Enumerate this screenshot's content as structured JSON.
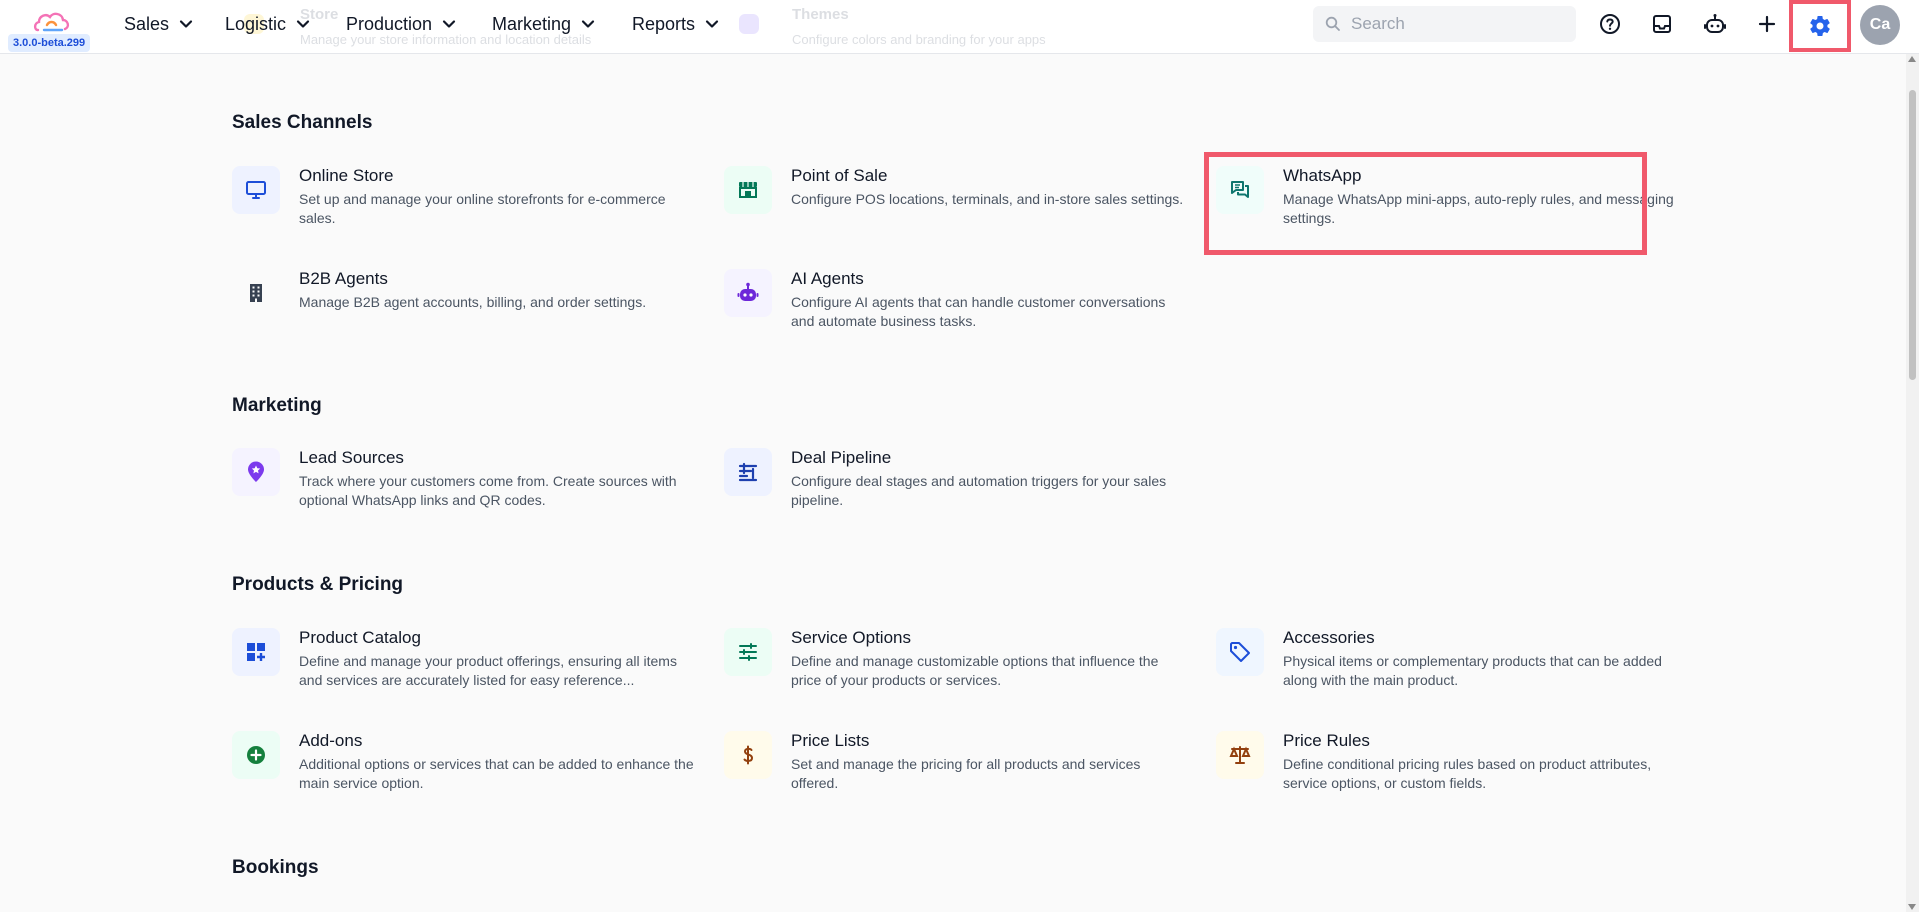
{
  "app": {
    "version": "3.0.0-beta.299"
  },
  "header": {
    "nav": [
      {
        "label": "Sales"
      },
      {
        "label": "Logistic"
      },
      {
        "label": "Production"
      },
      {
        "label": "Marketing"
      },
      {
        "label": "Reports"
      }
    ],
    "ghost": {
      "left_title": "Store",
      "left_sub": "Manage your store information and location details",
      "right_title": "Themes",
      "right_sub": "Configure colors and branding for your apps"
    },
    "search": {
      "placeholder": "Search",
      "value": ""
    },
    "icons": [
      "help-circle-icon",
      "inbox-icon",
      "robot-icon",
      "plus-icon",
      "gear-icon"
    ],
    "avatar_initials": "Ca"
  },
  "colors": {
    "highlight": "#f0596b",
    "accent": "#2563eb"
  },
  "sections": [
    {
      "title": "Sales Channels",
      "cards": [
        {
          "title": "Online Store",
          "desc": "Set up and manage your online storefronts for e-commerce sales.",
          "icon": "monitor-icon"
        },
        {
          "title": "Point of Sale",
          "desc": "Configure POS locations, terminals, and in-store sales settings.",
          "icon": "storefront-icon"
        },
        {
          "title": "WhatsApp",
          "desc": "Manage WhatsApp mini-apps, auto-reply rules, and messaging settings.",
          "icon": "chat-bubbles-icon"
        },
        {
          "title": "B2B Agents",
          "desc": "Manage B2B agent accounts, billing, and order settings.",
          "icon": "building-icon"
        },
        {
          "title": "AI Agents",
          "desc": "Configure AI agents that can handle customer conversations and automate business tasks.",
          "icon": "robot-icon"
        }
      ]
    },
    {
      "title": "Marketing",
      "cards": [
        {
          "title": "Lead Sources",
          "desc": "Track where your customers come from. Create sources with optional WhatsApp links and QR codes.",
          "icon": "location-pin-icon"
        },
        {
          "title": "Deal Pipeline",
          "desc": "Configure deal stages and automation triggers for your sales pipeline.",
          "icon": "pipeline-icon"
        }
      ]
    },
    {
      "title": "Products & Pricing",
      "cards": [
        {
          "title": "Product Catalog",
          "desc": "Define and manage your product offerings, ensuring all items and services are accurately listed for easy reference...",
          "icon": "grid-plus-icon"
        },
        {
          "title": "Service Options",
          "desc": "Define and manage customizable options that influence the price of your products or services.",
          "icon": "sliders-icon"
        },
        {
          "title": "Accessories",
          "desc": "Physical items or complementary products that can be added along with the main product.",
          "icon": "tag-icon"
        },
        {
          "title": "Add-ons",
          "desc": "Additional options or services that can be added to enhance the main service option.",
          "icon": "plus-circle-icon"
        },
        {
          "title": "Price Lists",
          "desc": "Set and manage the pricing for all products and services offered.",
          "icon": "dollar-icon"
        },
        {
          "title": "Price Rules",
          "desc": "Define conditional pricing rules based on product attributes, service options, or custom fields.",
          "icon": "scale-icon"
        }
      ]
    },
    {
      "title": "Bookings",
      "cards": []
    }
  ]
}
